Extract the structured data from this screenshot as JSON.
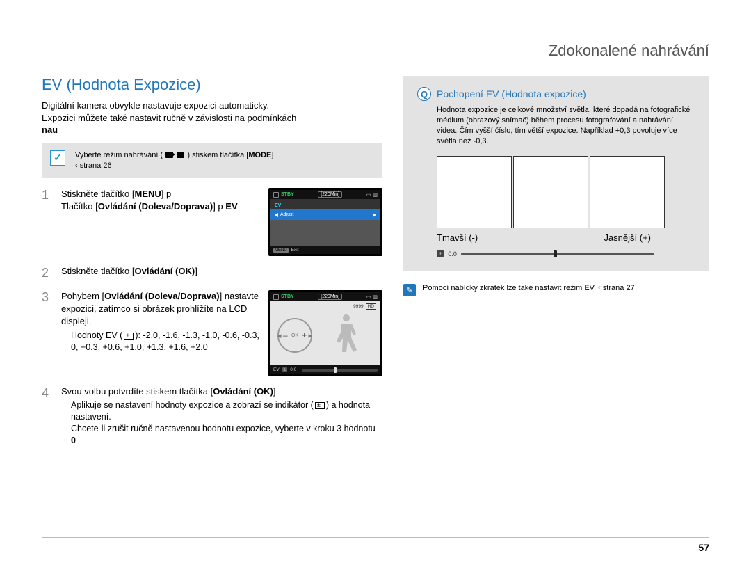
{
  "header": {
    "title": "Zdokonalené nahrávání"
  },
  "left": {
    "section_title": "EV (Hodnota Expozice)",
    "intro_1": "Digitální kamera obvykle nastavuje expozici automaticky.",
    "intro_2": "Expozici můžete také nastavit ručně v závislosti na podmínkách",
    "intro_bold": "nau",
    "mode_box_pre": "Vyberte režim nahrávání (",
    "mode_box_post": ") stiskem tlačítka [",
    "mode_box_btn": "MODE",
    "mode_box_end": "]",
    "mode_box_ref": "‹ strana 26",
    "steps": {
      "1": {
        "line1_pre": "Stiskněte tlačítko [",
        "line1_btn": "MENU",
        "line1_post": "]  p",
        "line2_pre": "Tlačítko [",
        "line2_bold": "Ovládání (Doleva/Doprava)",
        "line2_post": "]  p ",
        "line2_ev": "EV"
      },
      "2": {
        "pre": "Stiskněte tlačítko [",
        "bold": "Ovládání (OK)",
        "post": "]"
      },
      "3": {
        "pre": "Pohybem [",
        "bold": "Ovládání (Doleva/Doprava)",
        "post": "] nastavte expozici, zatímco si obrázek prohlížíte na LCD displeji.",
        "sub_pre": "Hodnoty EV (",
        "sub_post": "): -2.0, -1.6, -1.3, -1.0, -0.6, -0.3, 0, +0.3, +0.6, +1.0, +1.3, +1.6, +2.0"
      },
      "4": {
        "line1_pre": "Svou volbu potvrdíte stiskem tlačítka [",
        "line1_bold": "Ovládání (OK)",
        "line1_post": "]",
        "sub1": "Aplikuje se nastavení hodnoty expozice a zobrazí se indikátor (",
        "sub1_post": ") a hodnota nastavení.",
        "sub2_pre": "Chcete-li zrušit ručně nastavenou hodnotu expozice, vyberte v kroku 3 hodnotu ",
        "sub2_bold": "0"
      }
    },
    "lcd1": {
      "stby": "STBY",
      "time": "[220Min]",
      "ev_label": "EV",
      "adjust": "Adjust",
      "menu": "MENU",
      "exit": "Exit"
    },
    "lcd2": {
      "stby": "STBY",
      "time": "[220Min]",
      "count": "9999",
      "ev_label": "EV",
      "ev_val": "0.0"
    }
  },
  "right": {
    "info_title": "Pochopení EV (Hodnota expozice)",
    "info_text": "Hodnota expozice je celkové množství světla, které dopadá na fotografické médium (obrazový snímač) během procesu fotografování a nahrávání videa. Čím vyšší číslo, tím větší expozice. Například +0,3 povoluje více světla než -0,3.",
    "label_dark": "Tmavší (-)",
    "label_bright": "Jasnější (+)",
    "slider_val": "0.0",
    "note": "Pomocí nabídky zkratek lze také nastavit režim EV.  ‹ strana 27"
  },
  "page_num": "57",
  "chart_data": {
    "type": "table",
    "title": "EV exposure values",
    "values": [
      -2.0,
      -1.6,
      -1.3,
      -1.0,
      -0.6,
      -0.3,
      0,
      0.3,
      0.6,
      1.0,
      1.3,
      1.6,
      2.0
    ]
  }
}
